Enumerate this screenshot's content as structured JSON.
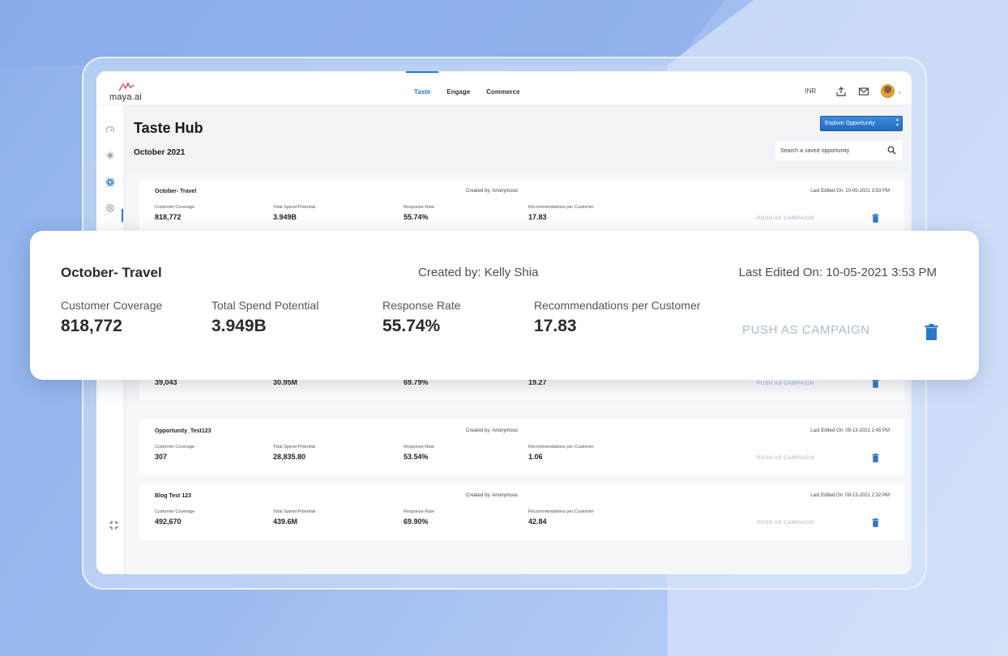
{
  "app": {
    "logo_text": "maya.ai"
  },
  "nav": {
    "tabs": [
      {
        "label": "Taste",
        "active": true
      },
      {
        "label": "Engage",
        "active": false
      },
      {
        "label": "Commerce",
        "active": false
      }
    ],
    "currency": "INR",
    "icons": [
      "upload-icon",
      "mail-icon",
      "avatar",
      "chevron-down-icon"
    ]
  },
  "sidebar": {
    "icons": [
      "gauge-icon",
      "sparkle-icon",
      "atom-icon",
      "settings-icon"
    ],
    "active_index": 2,
    "collapse_icon": "collapse-icon"
  },
  "page": {
    "title": "Taste Hub",
    "month": "October 2021",
    "explore_button": "Explore Opportunity",
    "search_placeholder": "Search a saved opportunity"
  },
  "metric_labels": {
    "coverage": "Customer Coverage",
    "spend": "Total Spend Potential",
    "response": "Response Rate",
    "recs": "Recommendations per Customer",
    "push": "PUSH AS CAMPAIGN"
  },
  "cards": [
    {
      "title": "October- Travel",
      "created_by": "Created by: Anonymous",
      "last_edited": "Last Edited On: 10-05-2021 3:53 PM",
      "coverage": "818,772",
      "spend": "3.949B",
      "response": "55.74%",
      "recs": "17.83"
    },
    {
      "coverage": "39,043",
      "spend": "30.95M",
      "response": "69.79%",
      "recs": "19.27"
    },
    {
      "title": "Opportunity_Test123",
      "created_by": "Created by: Anonymous",
      "last_edited": "Last Edited On: 09-13-2021 2:45 PM",
      "coverage": "307",
      "spend": "28,835.80",
      "response": "53.54%",
      "recs": "1.06"
    },
    {
      "title": "Blog Test 123",
      "created_by": "Created by: Anonymous",
      "last_edited": "Last Edited On: 09-13-2021 2:32 PM",
      "coverage": "492,670",
      "spend": "439.6M",
      "response": "69.90%",
      "recs": "42.84"
    }
  ],
  "zoom": {
    "title": "October- Travel",
    "created_by": "Created by: Kelly Shia",
    "last_edited": "Last Edited On: 10-05-2021 3:53 PM",
    "coverage": "818,772",
    "spend": "3.949B",
    "response": "55.74%",
    "recs": "17.83"
  },
  "colors": {
    "accent": "#2c78c9",
    "push_text": "#9fb3c8",
    "trash": "#2c78c9",
    "background": "#a9c3ef"
  }
}
